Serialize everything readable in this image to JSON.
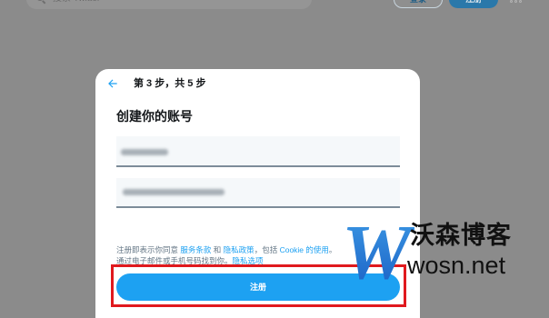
{
  "topbar": {
    "search_placeholder": "搜索 Twitter",
    "login_label": "登录",
    "signup_label": "注册"
  },
  "modal": {
    "step_text": "第 3 步，共 5 步",
    "title": "创建你的账号",
    "legal": {
      "prefix": "注册即表示你同意",
      "terms_link": "服务条款",
      "and": "和",
      "privacy_link": "隐私政策",
      "including": "，包括",
      "cookie_link": "Cookie 的使用",
      "period": "。",
      "line2_text": "通过电子邮件或手机号码找到你。",
      "privacy_options_link": "隐私选项"
    },
    "submit_label": "注册"
  },
  "watermark": {
    "logo_letter": "W",
    "brand_name": "沃森博客",
    "domain": "wosn.net"
  },
  "icons": {
    "back": "arrow-left-icon",
    "search": "search-icon",
    "more": "more-icon"
  },
  "colors": {
    "accent": "#1DA1F2",
    "highlight": "#E0191E"
  }
}
